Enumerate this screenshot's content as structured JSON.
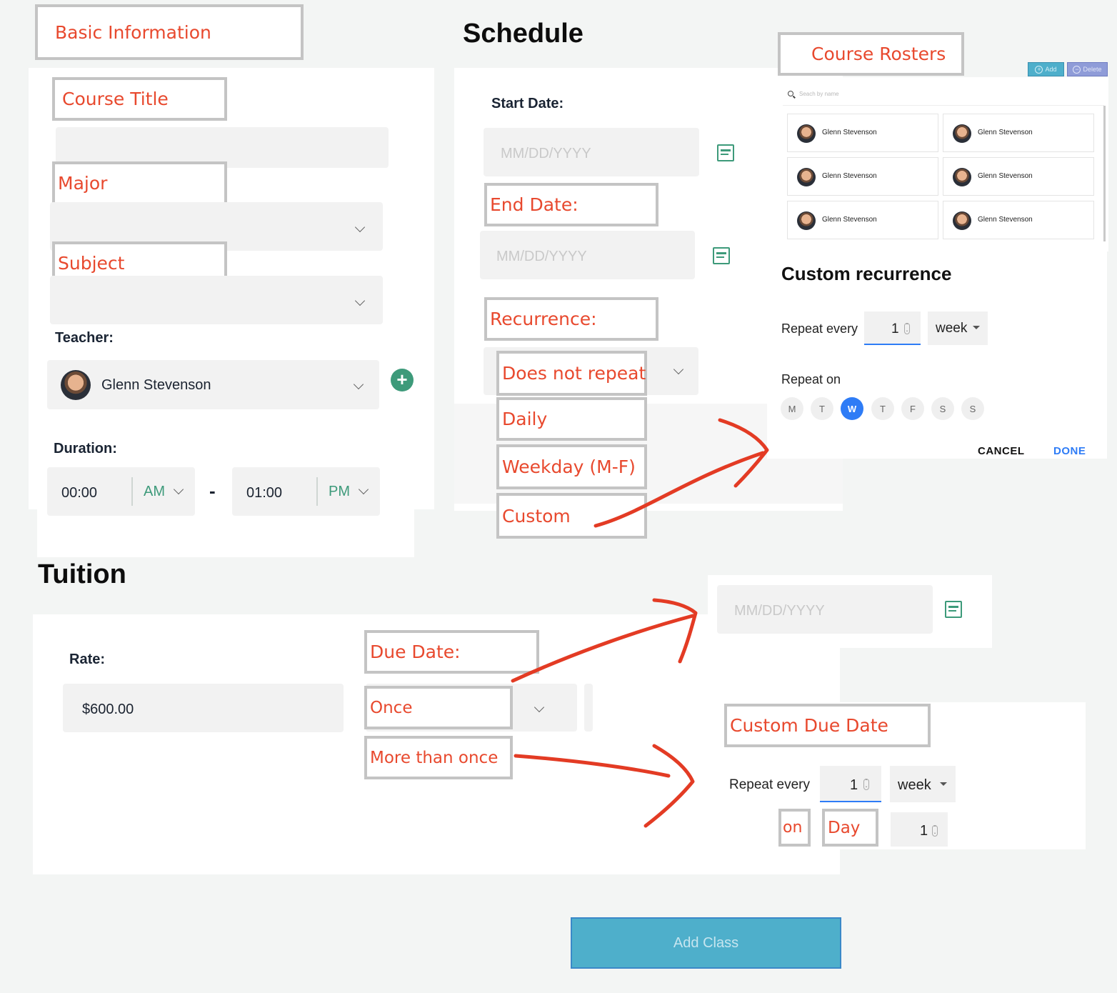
{
  "basic": {
    "section_tag": "Basic Information",
    "course_title_tag": "Course Title",
    "major_tag": "Major",
    "subject_tag": "Subject",
    "teacher_label": "Teacher:",
    "teacher_name": "Glenn Stevenson",
    "duration_label": "Duration:",
    "start_time": "00:00",
    "start_period": "AM",
    "dash": "-",
    "end_time": "01:00",
    "end_period": "PM"
  },
  "schedule": {
    "title": "Schedule",
    "start_label": "Start Date:",
    "date_placeholder": "MM/DD/YYYY",
    "end_tag": "End Date:",
    "recurrence_tag": "Recurrence:",
    "options": [
      "Does not repeat",
      "Daily",
      "Weekday (M-F)",
      "Custom"
    ]
  },
  "rosters": {
    "tag": "Course Rosters",
    "add_label": "Add",
    "delete_label": "Delete",
    "search_placeholder": "Seach by name",
    "students": [
      "Glenn Stevenson",
      "Glenn Stevenson",
      "Glenn Stevenson",
      "Glenn Stevenson",
      "Glenn Stevenson",
      "Glenn Stevenson"
    ]
  },
  "custom_recurrence": {
    "title": "Custom recurrence",
    "repeat_every_label": "Repeat every",
    "repeat_value": "1",
    "unit": "week",
    "repeat_on_label": "Repeat on",
    "days": [
      "M",
      "T",
      "W",
      "T",
      "F",
      "S",
      "S"
    ],
    "selected_day_index": 2,
    "cancel": "CANCEL",
    "done": "DONE"
  },
  "tuition": {
    "title": "Tuition",
    "rate_label": "Rate:",
    "rate_value": "$600.00",
    "due_tag": "Due Date:",
    "options": [
      "Once",
      "More than once"
    ],
    "date_placeholder": "MM/DD/YYYY"
  },
  "custom_due": {
    "tag": "Custom Due Date",
    "repeat_every_label": "Repeat every",
    "repeat_value": "1",
    "unit": "week",
    "on_tag": "on",
    "day_tag": "Day",
    "day_value": "1"
  },
  "submit": {
    "label": "Add Class"
  },
  "colors": {
    "tag_text": "#e8492e",
    "tag_border": "#c4c4c4",
    "accent_green": "#3d9a7a",
    "accent_blue": "#2e7cf6",
    "submit_bg": "#4eafcb",
    "arrow": "#e33b24"
  }
}
